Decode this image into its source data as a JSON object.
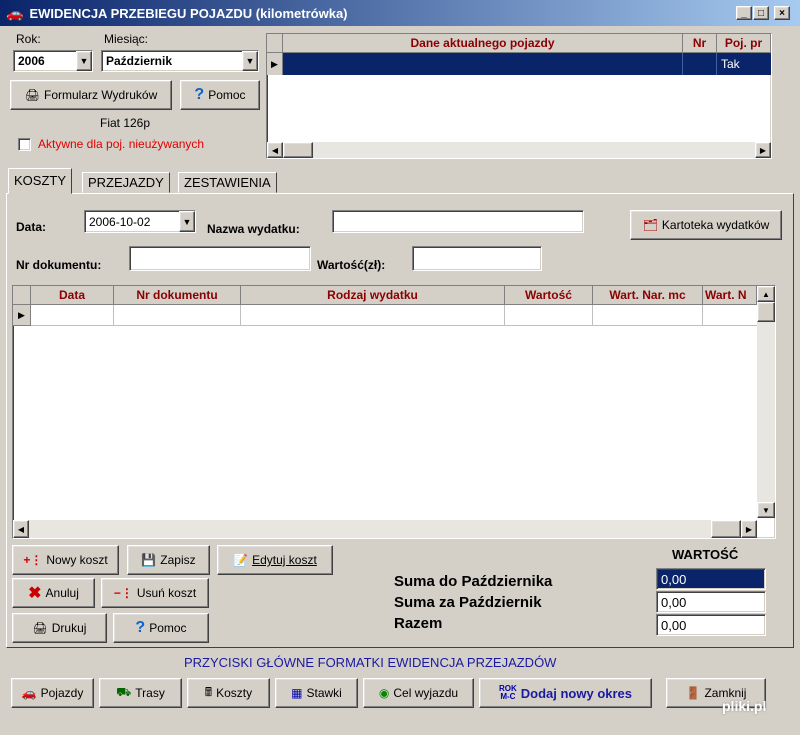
{
  "window": {
    "title": "EWIDENCJA PRZEBIEGU POJAZDU (kilometrówka)",
    "controls": {
      "minimize": "_",
      "maximize": "□",
      "close": "×"
    }
  },
  "top": {
    "rok_label": "Rok:",
    "rok_value": "2006",
    "miesiac_label": "Miesiąc:",
    "miesiac_value": "Październik",
    "formularz_button": "Formularz Wydruków",
    "pomoc_button": "Pomoc",
    "vehicle_name": "Fiat 126p",
    "aktywne_checkbox": "Aktywne dla poj. nieużywanych"
  },
  "vehicle_grid": {
    "headers": [
      "Dane aktualnego pojazdy",
      "Nr",
      "Poj. pr"
    ],
    "rows": [
      [
        "",
        "",
        "Tak"
      ]
    ]
  },
  "tabs": [
    "KOSZTY",
    "PRZEJAZDY",
    "ZESTAWIENIA"
  ],
  "form": {
    "data_label": "Data:",
    "data_value": "2006-10-02",
    "nazwa_label": "Nazwa wydatku:",
    "nazwa_value": "",
    "kartoteka_button": "Kartoteka wydatków",
    "nr_dok_label": "Nr dokumentu:",
    "nr_dok_value": "",
    "wartosc_label": "Wartość(zł):",
    "wartosc_value": ""
  },
  "cost_grid": {
    "headers": [
      "Data",
      "Nr dokumentu",
      "Rodzaj wydatku",
      "Wartość",
      "Wart. Nar. mc",
      "Wart. N"
    ]
  },
  "actions": {
    "nowy_koszt": "Nowy koszt",
    "zapisz": "Zapisz",
    "edytuj_koszt": "Edytuj koszt",
    "anuluj": "Anuluj",
    "usun_koszt": "Usuń koszt",
    "drukuj": "Drukuj",
    "pomoc": "Pomoc"
  },
  "summary": {
    "title": "WARTOŚĆ",
    "rows": [
      {
        "label": "Suma do Października",
        "value": "0,00"
      },
      {
        "label": "Suma za Październik",
        "value": "0,00"
      },
      {
        "label": "Razem",
        "value": "0,00"
      }
    ]
  },
  "main_buttons": {
    "section_title": "PRZYCISKI GŁÓWNE FORMATKI EWIDENCJA PRZEJAZDÓW",
    "pojazdy": "Pojazdy",
    "trasy": "Trasy",
    "koszty": "Koszty",
    "stawki": "Stawki",
    "cel_wyjazdu": "Cel wyjazdu",
    "dodaj_okres_icon_top": "ROK",
    "dodaj_okres_icon_bottom": "M-C",
    "dodaj_okres": "Dodaj nowy okres",
    "zamknij": "Zamknij"
  },
  "watermark": "pliki.pl",
  "colors": {
    "header_red": "#8b0000",
    "selected_row": "#0a246a",
    "section_blue": "#1a1aa0",
    "checkbox_red": "#e00000"
  }
}
